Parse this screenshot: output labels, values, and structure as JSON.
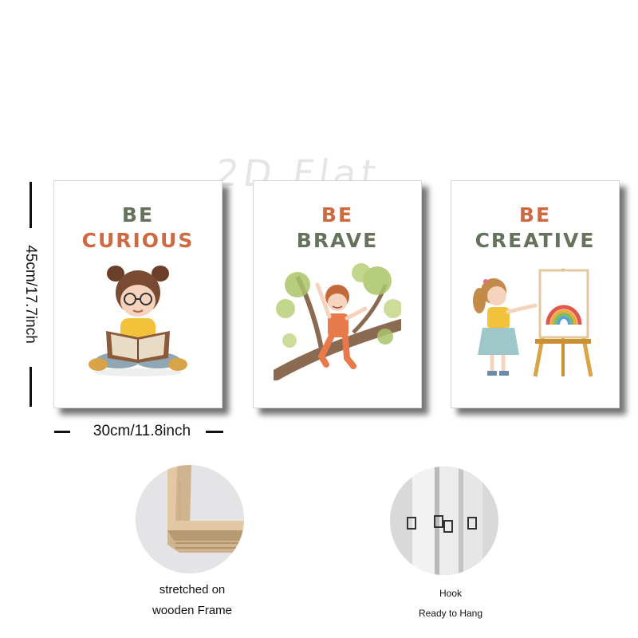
{
  "watermark": "2D Flat",
  "canvases": [
    {
      "line1": "BE",
      "line2": "CURIOUS"
    },
    {
      "line1": "BE",
      "line2": "BRAVE"
    },
    {
      "line1": "BE",
      "line2": "CREATIVE"
    }
  ],
  "dimensions": {
    "height_label": "45cm/17.7inch",
    "width_label": "30cm/11.8inch"
  },
  "features": {
    "frame_caption_1": "stretched on",
    "frame_caption_2": "wooden Frame",
    "hook_caption_1": "Hook",
    "hook_caption_2": "Ready to Hang"
  },
  "colors": {
    "green_text": "#65725c",
    "orange_text": "#cd6a42"
  }
}
